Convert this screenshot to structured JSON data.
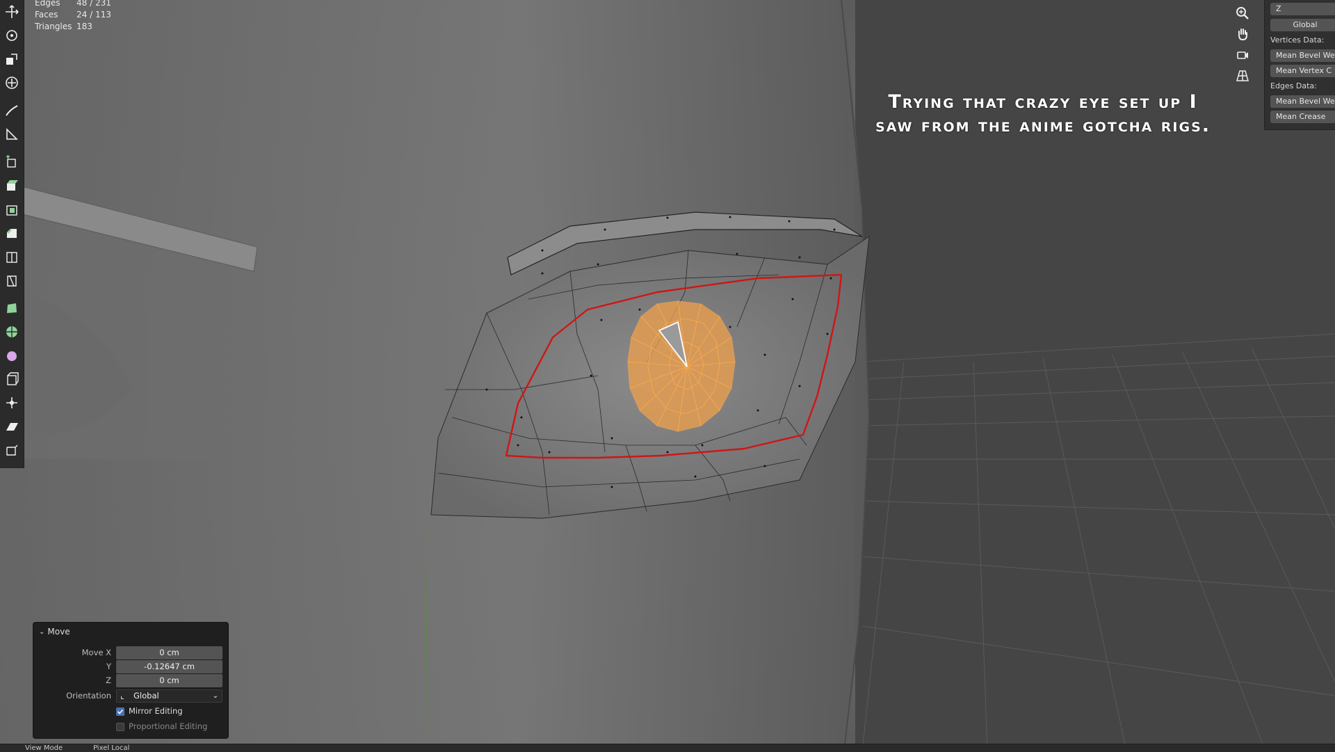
{
  "stats": [
    {
      "label": "Edges",
      "value": "48 / 231"
    },
    {
      "label": "Faces",
      "value": "24 / 113"
    },
    {
      "label": "Triangles",
      "value": "183"
    }
  ],
  "toolbar": {
    "tools": [
      "move-icon",
      "rotate-icon",
      "scale-icon",
      "transform-icon",
      "annotate-icon",
      "measure-icon",
      "add-cube-icon",
      "extrude-icon",
      "inset-icon",
      "bevel-icon",
      "loop-cut-icon",
      "knife-icon",
      "poly-build-icon",
      "spin-icon",
      "smooth-icon",
      "edge-slide-icon",
      "shrink-fatten-icon",
      "shear-icon",
      "rip-icon"
    ]
  },
  "nav_buttons": [
    "zoom-icon",
    "pan-hand-icon",
    "camera-icon",
    "grid-perspective-icon"
  ],
  "npanel": {
    "axis_value": "Z",
    "space_button": "Global",
    "vertices_label": "Vertices Data:",
    "vertices_items": [
      "Mean Bevel We",
      "Mean Vertex C"
    ],
    "edges_label": "Edges Data:",
    "edges_items": [
      "Mean Bevel We",
      "Mean Crease"
    ]
  },
  "caption": {
    "line1": "Trying that crazy eye set up I",
    "line2": "saw from the anime gotcha rigs."
  },
  "operator": {
    "title": "Move",
    "move_x_label": "Move X",
    "move_x": "0 cm",
    "y_label": "Y",
    "y": "-0.12647 cm",
    "z_label": "Z",
    "z": "0 cm",
    "orientation_label": "Orientation",
    "orientation": "Global",
    "mirror_editing": "Mirror Editing",
    "mirror_checked": true,
    "proportional_editing": "Proportional Editing",
    "proportional_checked": false
  },
  "statusbar": {
    "mode_label": "View   Mode",
    "mode_value": "Pixel   Local"
  },
  "colors": {
    "selection_outline": "#d01515",
    "selected_faces": "#f0a04b",
    "active_face": "#ffffff",
    "checkbox_on": "#4772b3"
  }
}
